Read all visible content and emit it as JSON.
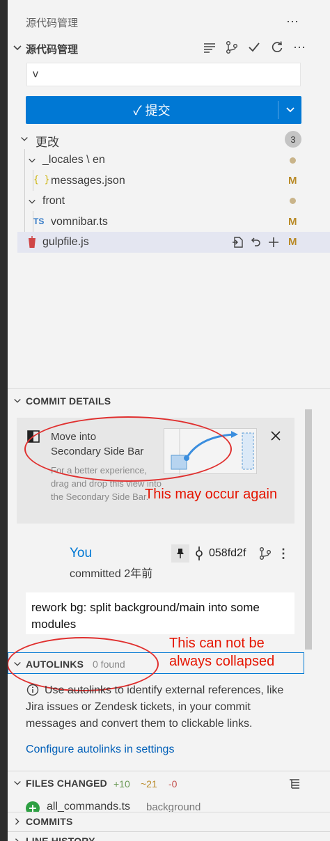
{
  "header": {
    "title": "源代码管理"
  },
  "scm": {
    "section_title": "源代码管理",
    "commit_input_value": "v",
    "commit_button_label": "✓ 提交",
    "changes_label": "更改",
    "changes_count": "3",
    "tree": [
      {
        "label": "_locales \\ en",
        "type": "folder"
      },
      {
        "label": "messages.json",
        "type": "file",
        "icon": "{ }",
        "status": "M"
      },
      {
        "label": "front",
        "type": "folder"
      },
      {
        "label": "vomnibar.ts",
        "type": "file",
        "icon": "TS",
        "status": "M"
      },
      {
        "label": "gulpfile.js",
        "type": "file",
        "status": "M"
      }
    ]
  },
  "commit_details": {
    "section_title": "COMMIT DETAILS",
    "hint_title_1": "Move into",
    "hint_title_2": "Secondary Side Bar",
    "hint_body": "For a better experience, drag and drop this view into the Secondary Side Bar.",
    "author": "You",
    "committed": "committed 2年前",
    "sha": "058fd2f",
    "message": "rework bg: split background/main into some modules"
  },
  "autolinks": {
    "section_title": "AUTOLINKS",
    "found": "0 found",
    "info_text": "Use autolinks to identify external references, like Jira issues or Zendesk tickets, in your commit messages and convert them to clickable links.",
    "configure_link": "Configure autolinks in settings"
  },
  "files_changed": {
    "section_title": "FILES CHANGED",
    "additions": "+10",
    "changes": "~21",
    "deletions": "-0",
    "first_file": "all_commands.ts",
    "first_file_dir": "background"
  },
  "commits": {
    "section_title": "COMMITS"
  },
  "line_history": {
    "section_title": "LINE HISTORY"
  },
  "annotations": {
    "note1": "This may occur again",
    "note2_line1": "This can not be",
    "note2_line2": "always collapsed"
  },
  "colors": {
    "accent": "#0078d4",
    "annotation": "#e51400",
    "modified": "#b98a27"
  }
}
